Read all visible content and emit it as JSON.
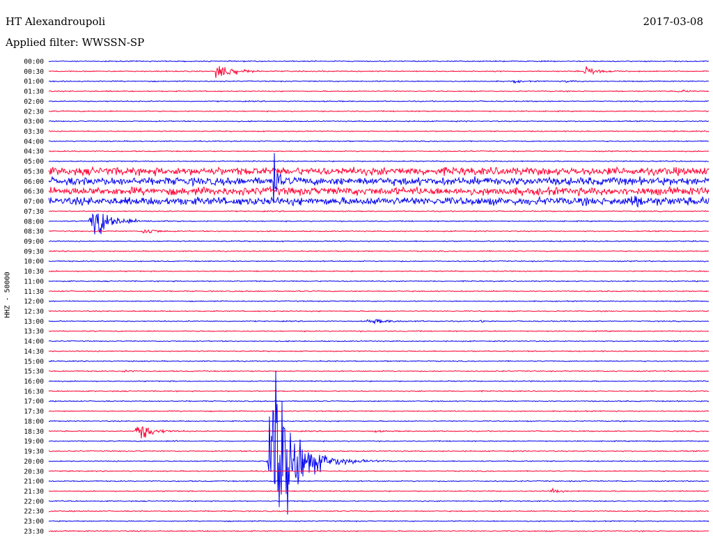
{
  "header": {
    "station": "HT Alexandroupoli",
    "date": "2017-03-08",
    "filter": "Applied filter: WWSSN-SP"
  },
  "colors": {
    "even_trace": "#0000ee",
    "odd_trace": "#ff0033",
    "text": "#000000"
  },
  "chart_data": {
    "type": "line",
    "title": "HT Alexandroupoli",
    "ylabel": "HHZ - 50000",
    "traces_per_row_hours": 0.5,
    "row_labels": [
      "00:00",
      "00:30",
      "01:00",
      "01:30",
      "02:00",
      "02:30",
      "03:00",
      "03:30",
      "04:00",
      "04:30",
      "05:00",
      "05:30",
      "06:00",
      "06:30",
      "07:00",
      "07:30",
      "08:00",
      "08:30",
      "09:00",
      "09:30",
      "10:00",
      "10:30",
      "11:00",
      "11:30",
      "12:00",
      "12:30",
      "13:00",
      "13:30",
      "14:00",
      "14:30",
      "15:00",
      "15:30",
      "16:00",
      "16:30",
      "17:00",
      "17:30",
      "18:00",
      "18:30",
      "19:00",
      "19:30",
      "20:00",
      "20:30",
      "21:00",
      "21:30",
      "22:00",
      "22:30",
      "23:00",
      "23:30"
    ],
    "noisy_rows": [
      "05:30",
      "06:00",
      "06:30",
      "07:00"
    ],
    "events": [
      {
        "row": "00:30",
        "time_fraction": 0.25,
        "amplitude": 3.0,
        "duration_fraction": 0.05
      },
      {
        "row": "00:30",
        "time_fraction": 0.81,
        "amplitude": 1.5,
        "duration_fraction": 0.04
      },
      {
        "row": "01:00",
        "time_fraction": 0.7,
        "amplitude": 0.4,
        "duration_fraction": 0.03
      },
      {
        "row": "01:00",
        "time_fraction": 0.78,
        "amplitude": 0.3,
        "duration_fraction": 0.03
      },
      {
        "row": "01:30",
        "time_fraction": 0.95,
        "amplitude": 0.3,
        "duration_fraction": 0.04
      },
      {
        "row": "06:00",
        "time_fraction": 0.34,
        "amplitude": 12.0,
        "duration_fraction": 0.01
      },
      {
        "row": "07:00",
        "time_fraction": 0.87,
        "amplitude": 0.8,
        "duration_fraction": 0.08
      },
      {
        "row": "08:00",
        "time_fraction": 0.06,
        "amplitude": 4.5,
        "duration_fraction": 0.07
      },
      {
        "row": "08:30",
        "time_fraction": 0.14,
        "amplitude": 1.0,
        "duration_fraction": 0.04
      },
      {
        "row": "13:00",
        "time_fraction": 0.48,
        "amplitude": 0.6,
        "duration_fraction": 0.07
      },
      {
        "row": "13:00",
        "time_fraction": 0.65,
        "amplitude": 0.4,
        "duration_fraction": 0.02
      },
      {
        "row": "15:30",
        "time_fraction": 0.11,
        "amplitude": 0.5,
        "duration_fraction": 0.02
      },
      {
        "row": "18:30",
        "time_fraction": 0.13,
        "amplitude": 2.8,
        "duration_fraction": 0.05
      },
      {
        "row": "18:30",
        "time_fraction": 0.49,
        "amplitude": 0.4,
        "duration_fraction": 0.02
      },
      {
        "row": "19:00",
        "time_fraction": 0.19,
        "amplitude": 0.3,
        "duration_fraction": 0.02
      },
      {
        "row": "20:00",
        "time_fraction": 0.33,
        "amplitude": 22.0,
        "duration_fraction": 0.09
      },
      {
        "row": "21:30",
        "time_fraction": 0.76,
        "amplitude": 0.6,
        "duration_fraction": 0.03
      },
      {
        "row": "22:00",
        "time_fraction": 0.66,
        "amplitude": 0.2,
        "duration_fraction": 0.02
      }
    ]
  }
}
